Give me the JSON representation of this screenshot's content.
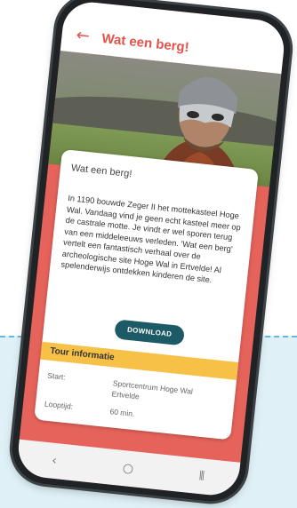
{
  "appbar": {
    "back_icon": "←",
    "title": "Wat een berg!"
  },
  "card": {
    "title": "Wat een berg!",
    "body": "In 1190 bouwde Zeger II het mottekasteel Hoge Wal. Vandaag vind je geen echt kasteel meer op de castrale motte. Je vindt er wel sporen terug van een middeleeuws verleden. 'Wat een berg' vertelt een fantastisch verhaal over de archeologische site Hoge Wal in Ertvelde! Al spelenderwijs ontdekken kinderen de site.",
    "download_label": "DOWNLOAD"
  },
  "tour_info": {
    "header": "Tour informatie",
    "rows": [
      {
        "label": "Start:",
        "value": "Sportcentrum Hoge Wal Ertvelde"
      },
      {
        "label": "Looptijd:",
        "value": "60 min."
      }
    ]
  },
  "navbar": {
    "back": "‹",
    "home": "○",
    "recents": "⦀"
  },
  "colors": {
    "accent": "#e5524a",
    "button": "#1c5a66",
    "section": "#f7c046",
    "background_band": "#dff1f7"
  }
}
